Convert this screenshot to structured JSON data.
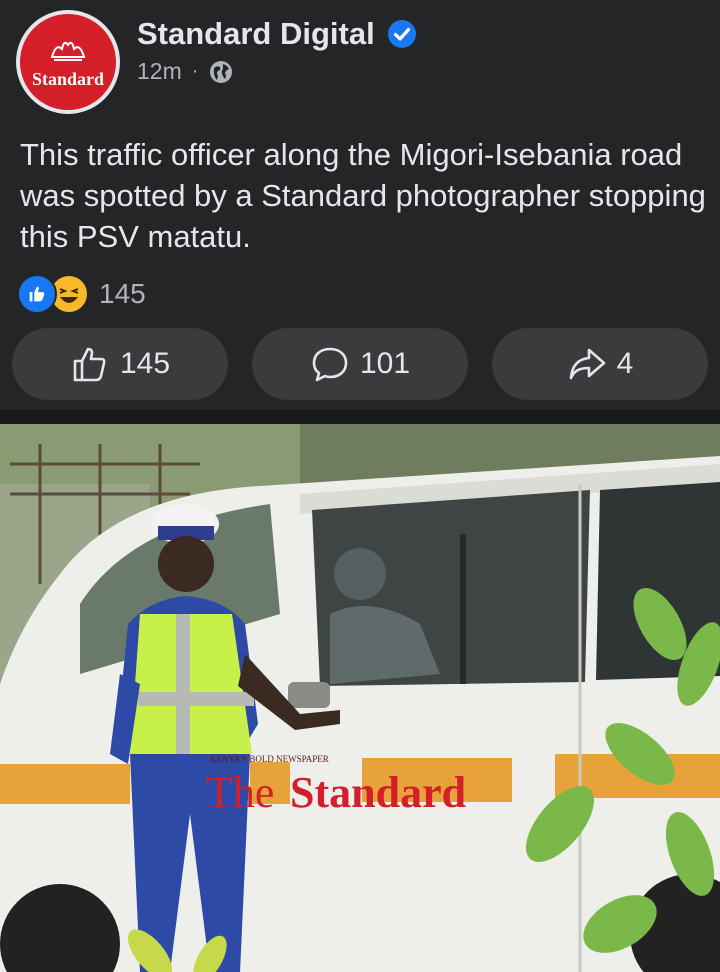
{
  "post": {
    "page_name": "Standard Digital",
    "avatar_text": "Standard",
    "time": "12m",
    "separator": "·",
    "text": "This traffic officer along the Migori-Isebania road was spotted by a Standard photographer stopping this PSV matatu.",
    "reaction_count": "145"
  },
  "actions": {
    "like_count": "145",
    "comment_count": "101",
    "share_count": "4"
  },
  "photo": {
    "watermark_small": "KENYA'S BOLD NEWSPAPER",
    "watermark_the": "The",
    "watermark_name": "Standard"
  },
  "icons": {
    "verified": "verified-badge-icon",
    "audience": "globe-icon",
    "like": "thumbs-up-icon",
    "comment": "comment-bubble-icon",
    "share": "share-arrow-icon"
  },
  "colors": {
    "background": "#242526",
    "button": "#3a3b3c",
    "brand_red": "#d41f29",
    "verified_blue": "#1877f2"
  }
}
